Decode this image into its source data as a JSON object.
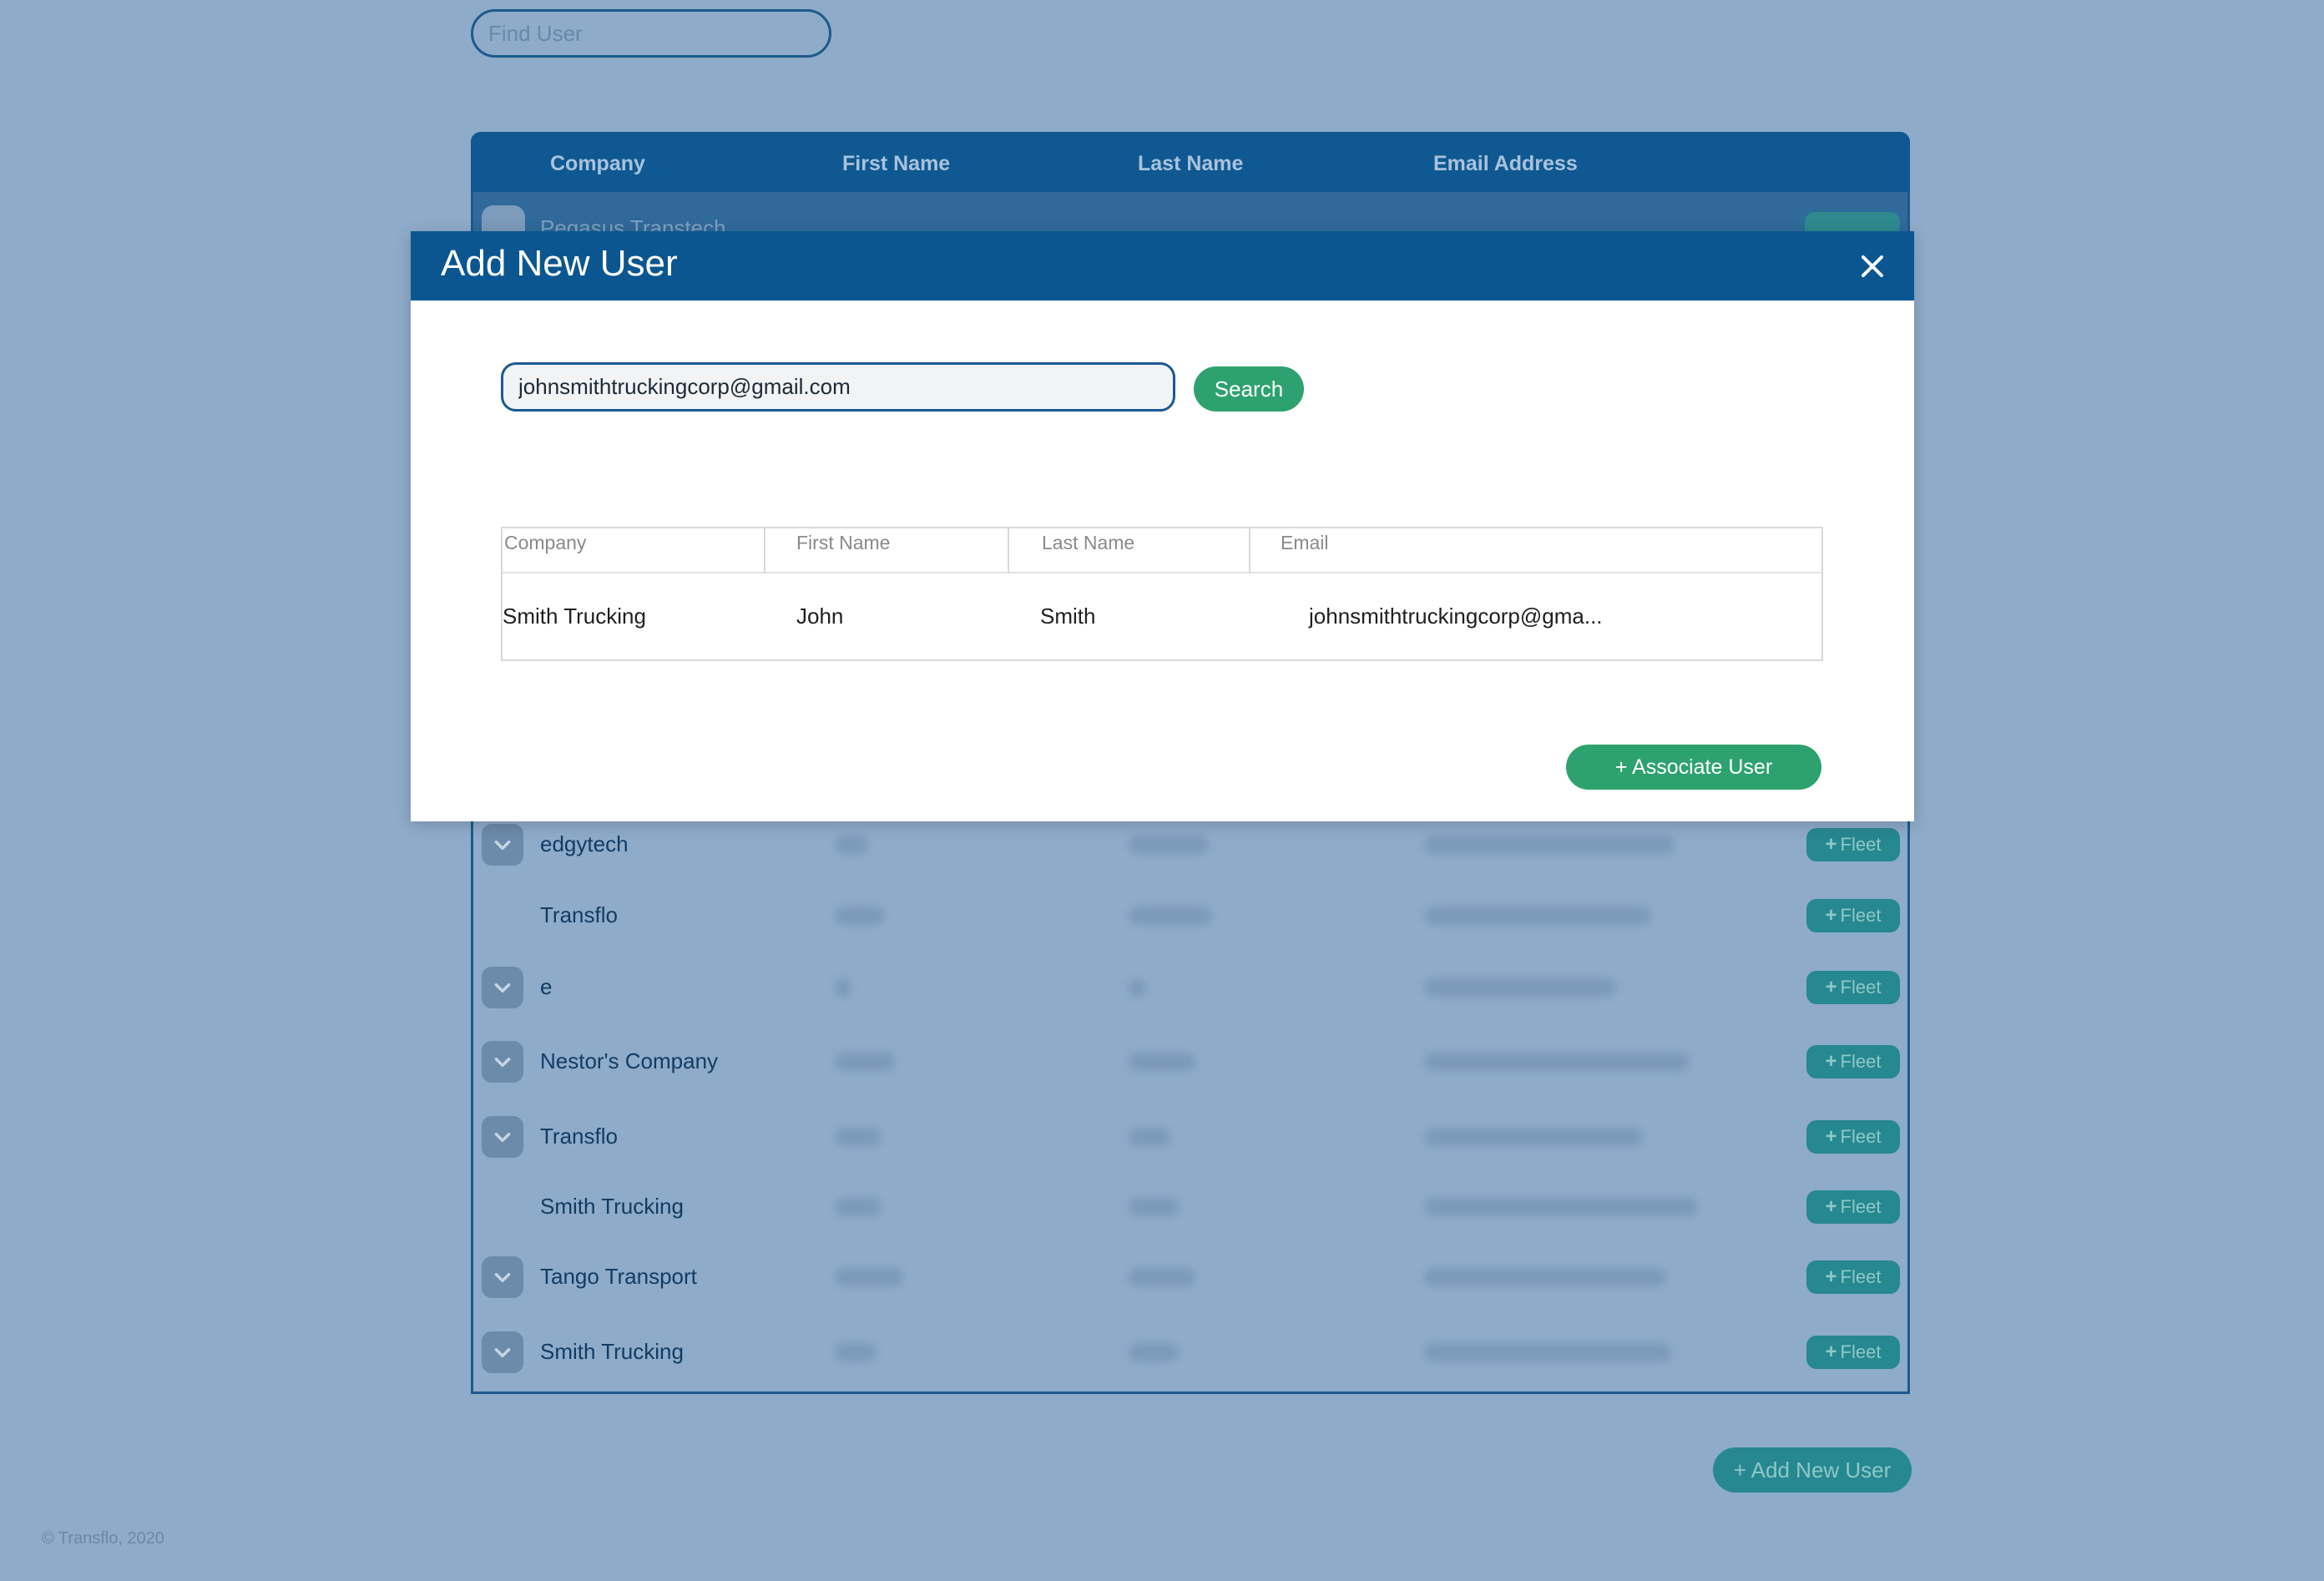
{
  "find_user": {
    "placeholder": "Find User"
  },
  "users_table": {
    "headers": [
      "Company",
      "First Name",
      "Last Name",
      "Email Address"
    ],
    "partial_row_company": "Pegasus Transtech",
    "rows": [
      {
        "company": "edgytech",
        "expandable": true
      },
      {
        "company": "Transflo",
        "expandable": false
      },
      {
        "company": "e",
        "expandable": true
      },
      {
        "company": "Nestor's Company",
        "expandable": true
      },
      {
        "company": "Transflo",
        "expandable": true
      },
      {
        "company": "Smith Trucking",
        "expandable": false
      },
      {
        "company": "Tango Transport",
        "expandable": true
      },
      {
        "company": "Smith Trucking",
        "expandable": true
      }
    ],
    "fleet_label": "Fleet"
  },
  "add_new_user_button": "+ Add New User",
  "copyright": "© Transflo, 2020",
  "modal": {
    "title": "Add New User",
    "search_value": "johnsmithtruckingcorp@gmail.com",
    "search_button": "Search",
    "result_headers": [
      "Company",
      "First Name",
      "Last Name",
      "Email"
    ],
    "result_row": {
      "company": "Smith Trucking",
      "first_name": "John",
      "last_name": "Smith",
      "email": "johnsmithtruckingcorp@gma..."
    },
    "associate_button": "+ Associate User"
  },
  "colors": {
    "page_bg": "#8eabc9",
    "header_blue": "#0b5690",
    "accent_green": "#2ea26e",
    "fleet_teal": "#268891"
  },
  "icons": {
    "close": "close-icon",
    "chevron": "chevron-down-icon",
    "plus": "plus-icon"
  }
}
